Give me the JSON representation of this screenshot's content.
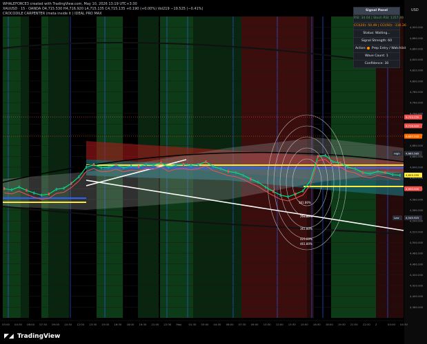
{
  "header": {
    "line1": "WHALEFORCE3 created with TradingView.com, May 10, 2026 13:19 UTC+3:30",
    "line2": "XAUUSD · 15 · OANDA  O4,715.530  H4,716.920  L4,715.135  C4,715.135  +0.190 (+0.00%)  Vol219  −19.525 (−0.41%)",
    "line3": "CROCODILE CARPENTER (meta inside it ) IDEAL PRO MAX"
  },
  "currency_label": "USD",
  "brand": {
    "name": "TradingView",
    "logo_icon": "tradingview-logo-icon"
  },
  "signal_panel": {
    "title": "Signal Panel",
    "rsi_line": "RSI: 34.04 | Stoch RSI: 1357.49",
    "cci_line": "CCI(20): 50.49 | CCI(50): -116.36",
    "status": "Status: Waiting...",
    "signal_strength": "Signal Strength: 60",
    "action_label": "Action:",
    "action_value": "Prep Entry / Watchlist",
    "wave_count": "Wave Count: 1",
    "confidence": "Confidence: 30"
  },
  "colors": {
    "bg": "#000000",
    "green_zone": "#0d3b17",
    "red_zone": "#3b0d0d",
    "teal_fill": "#1b6b73",
    "red_fill": "#b71c1c",
    "up_candle": "#26a69a",
    "down_candle": "#ef5350",
    "yellow_line": "#ffeb3b",
    "white_line": "#ffffff",
    "blue_line": "#2962ff",
    "bright_green": "#00e676"
  },
  "chart_data": {
    "type": "line",
    "symbol": "XAUUSD",
    "timeframe": "15",
    "ylim": [
      4360,
      4920
    ],
    "y_ticks": [
      4900,
      4880,
      4860,
      4840,
      4820,
      4800,
      4780,
      4760,
      4740,
      4720,
      4700,
      4680,
      4660,
      4640,
      4620,
      4600,
      4580,
      4560,
      4540,
      4520,
      4500,
      4480,
      4460,
      4440,
      4420,
      4400,
      4380
    ],
    "y_tick_labels": [
      "4,900.000",
      "4,880.000",
      "4,860.000",
      "4,840.000",
      "4,820.000",
      "4,800.000",
      "4,780.000",
      "4,760.000",
      "4,740.000",
      "4,720.000",
      "4,700.000",
      "4,680.000",
      "4,660.000",
      "4,640.000",
      "4,620.000",
      "4,600.000",
      "4,580.000",
      "4,560.000",
      "4,540.000",
      "4,520.000",
      "4,500.000",
      "4,480.000",
      "4,460.000",
      "4,440.000",
      "4,420.000",
      "4,400.000",
      "4,380.000"
    ],
    "x_tick_labels": [
      "03:00",
      "04:30",
      "06:00",
      "07:30",
      "09:00",
      "10:30",
      "12:00",
      "13:30",
      "15:00",
      "16:30",
      "18:00",
      "19:30",
      "21:00",
      "22:30",
      "May",
      "01:30",
      "03:00",
      "04:30",
      "06:00",
      "07:30",
      "09:00",
      "10:30",
      "12:00",
      "13:30",
      "15:00",
      "16:30",
      "18:00",
      "19:30",
      "21:00",
      "22:30",
      "2",
      "03:00",
      "04:30"
    ],
    "price_tags": [
      {
        "label": "4,733.250",
        "value": 4733.25,
        "color": "#ef5350"
      },
      {
        "label": "4,716.920",
        "value": 4716.92,
        "color": "#ef5350"
      },
      {
        "label": "4,697.535",
        "value": 4697.535,
        "color": "#ff6d00"
      },
      {
        "label": "High",
        "value": 4665.585,
        "color": "#2a2e39"
      },
      {
        "label": "4,665.585",
        "value": 4665.585,
        "color": "#2a2e39"
      },
      {
        "label": "4,625.255",
        "value": 4625.255,
        "color": "#ffeb3b"
      },
      {
        "label": "4,600.000",
        "value": 4600,
        "color": "#ef5350"
      },
      {
        "label": "Low",
        "value": 4545.925,
        "color": "#2a2e39"
      },
      {
        "label": "4,545.925",
        "value": 4545.925,
        "color": "#2a2e39"
      }
    ],
    "fib_labels": [
      "161.80%",
      "261.80%",
      "361.80%",
      "423.60%",
      "461.80%"
    ],
    "series": [
      {
        "name": "",
        "values": [
          4600,
          4598,
          4603,
          4597,
          4592,
          4588,
          4590,
          4599,
          4601,
          4610,
          4622,
          4640,
          4645,
          4639,
          4640,
          4644,
          4639,
          4642,
          4641,
          4645,
          4644,
          4648,
          4640,
          4644,
          4645,
          4643,
          4645,
          4650,
          4641,
          4637,
          4632,
          4630,
          4625,
          4618,
          4612,
          4603,
          4595,
          4588,
          4585,
          4590,
          4596,
          4615,
          4660,
          4662,
          4650,
          4648,
          4640,
          4637,
          4630,
          4628,
          4632,
          4630,
          4626,
          4625
        ]
      }
    ]
  }
}
